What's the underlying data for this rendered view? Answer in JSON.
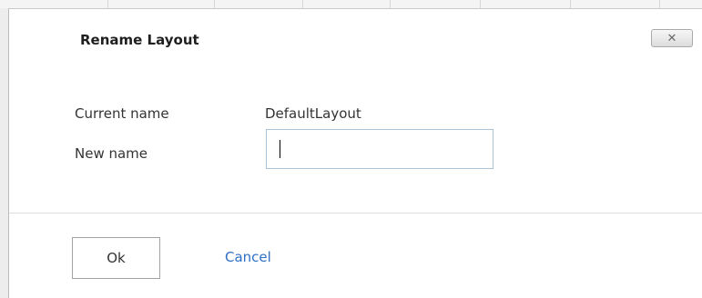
{
  "dialog": {
    "title": "Rename Layout",
    "close_label": "✕"
  },
  "form": {
    "current_name_label": "Current name",
    "current_name_value": "DefaultLayout",
    "new_name_label": "New name",
    "new_name_value": ""
  },
  "footer": {
    "ok_label": "Ok",
    "cancel_label": "Cancel"
  },
  "colors": {
    "link": "#2f6fc4",
    "input_border": "#a9c3d9"
  }
}
